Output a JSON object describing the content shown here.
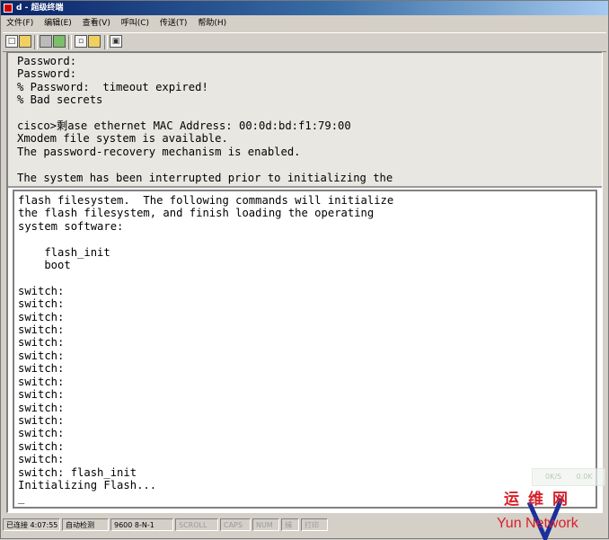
{
  "window": {
    "title": "d - 超级终端"
  },
  "menu": {
    "items": [
      "文件(F)",
      "编辑(E)",
      "查看(V)",
      "呼叫(C)",
      "传送(T)",
      "帮助(H)"
    ]
  },
  "toolbar": {
    "icons": [
      "new-icon",
      "open-icon",
      "connect-icon",
      "disconnect-icon",
      "send-icon",
      "receive-icon",
      "properties-icon"
    ]
  },
  "terminal": {
    "top_lines": "Password:\nPassword:\n% Password:  timeout expired!\n% Bad secrets\n\ncisco>剩ase ethernet MAC Address: 00:0d:bd:f1:79:00\nXmodem file system is available.\nThe password-recovery mechanism is enabled.\n\nThe system has been interrupted prior to initializing the",
    "main_lines": "flash filesystem.  The following commands will initialize\nthe flash filesystem, and finish loading the operating\nsystem software:\n\n    flash_init\n    boot\n\nswitch:\nswitch:\nswitch:\nswitch:\nswitch:\nswitch:\nswitch:\nswitch:\nswitch:\nswitch:\nswitch:\nswitch:\nswitch:\nswitch:\nswitch: flash_init\nInitializing Flash...\n_"
  },
  "float_meter": {
    "left": "0K/S",
    "right": "0.0K"
  },
  "status": {
    "connected": "已连接 4:07:55",
    "detect": "自动检测",
    "params": "9600 8-N-1",
    "scroll": "SCROLL",
    "caps": "CAPS",
    "num": "NUM",
    "capture": "捕",
    "print": "打印"
  },
  "watermark": {
    "cn": "运维网",
    "en": "Yun Network"
  }
}
